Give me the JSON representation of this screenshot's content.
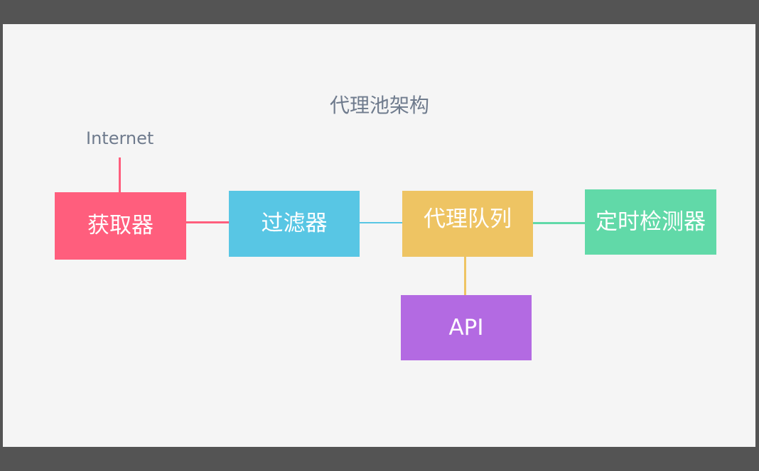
{
  "diagram": {
    "title": "代理池架构",
    "source_label": "Internet",
    "nodes": {
      "fetcher": {
        "label": "获取器",
        "color": "#ff5e7d"
      },
      "filter": {
        "label": "过滤器",
        "color": "#58c6e4"
      },
      "queue": {
        "label": "代理队列",
        "color": "#eec463"
      },
      "checker": {
        "label": "定时检测器",
        "color": "#61d9a8"
      },
      "api": {
        "label": "API",
        "color": "#b36ae2"
      }
    },
    "edges": [
      {
        "from": "Internet",
        "to": "获取器"
      },
      {
        "from": "获取器",
        "to": "过滤器"
      },
      {
        "from": "过滤器",
        "to": "代理队列"
      },
      {
        "from": "代理队列",
        "to": "定时检测器"
      },
      {
        "from": "代理队列",
        "to": "API"
      }
    ]
  }
}
